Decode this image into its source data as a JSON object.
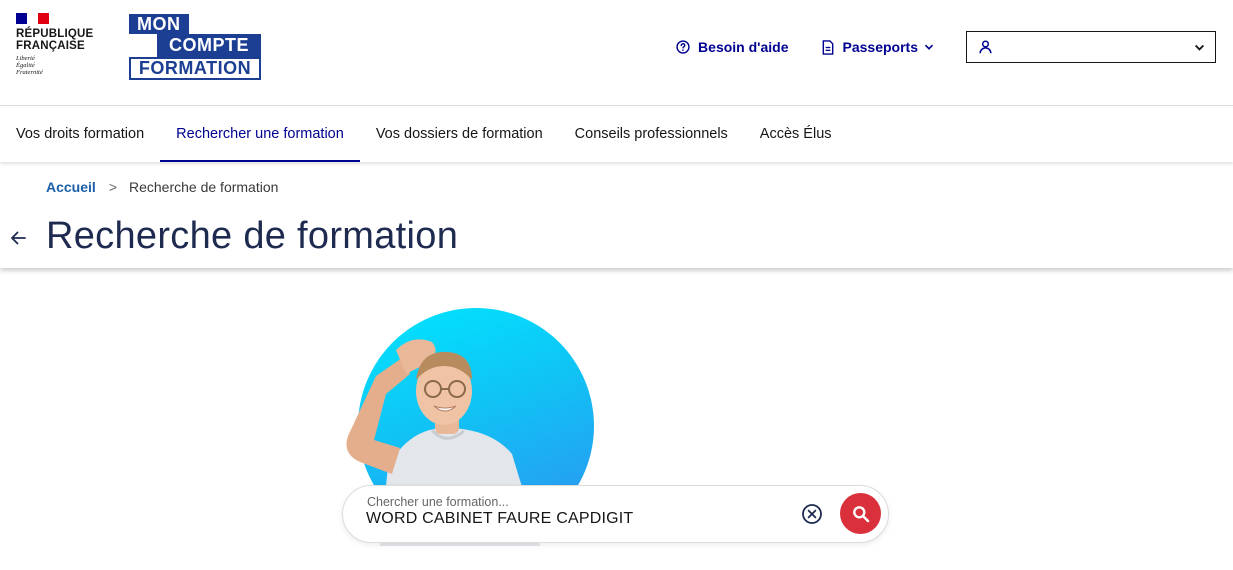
{
  "brand": {
    "republic_name": "RÉPUBLIQUE FRANÇAISE",
    "motto": [
      "Liberté",
      "Égalité",
      "Fraternité"
    ],
    "logo_lines": [
      "MON",
      "COMPTE",
      "FORMATION"
    ],
    "logo_color": "#1c3f94"
  },
  "header_tools": {
    "help_label": "Besoin d'aide",
    "passports_label": "Passeports",
    "account_value": ""
  },
  "nav": {
    "items": [
      {
        "label": "Vos droits formation",
        "active": false
      },
      {
        "label": "Rechercher une formation",
        "active": true
      },
      {
        "label": "Vos dossiers de formation",
        "active": false
      },
      {
        "label": "Conseils professionnels",
        "active": false
      },
      {
        "label": "Accès Élus",
        "active": false
      }
    ]
  },
  "breadcrumb": {
    "home": "Accueil",
    "separator": ">",
    "current": "Recherche de formation"
  },
  "page": {
    "title": "Recherche de formation"
  },
  "search": {
    "label": "Chercher une formation...",
    "value": "WORD CABINET FAURE CAPDIGIT"
  },
  "colors": {
    "primary_blue": "#000091",
    "title_navy": "#1e2a4f",
    "search_button_red": "#d9303c",
    "hero_cyan": "#00e6ff"
  }
}
